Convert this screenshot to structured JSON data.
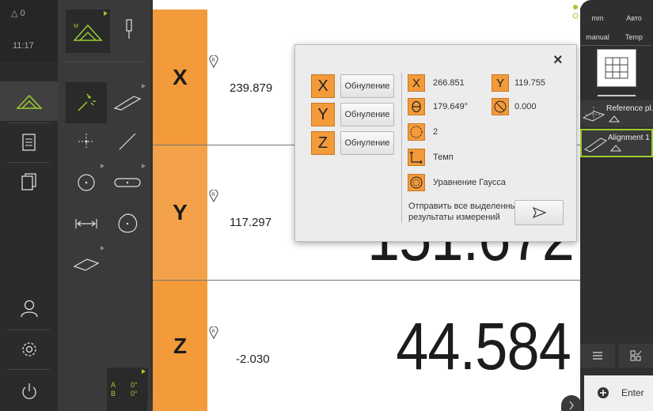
{
  "status": {
    "delta_label": "△ 0",
    "time": "11:17"
  },
  "function_panel": {
    "axes_a": "A",
    "axes_b": "B",
    "a_val": "0°",
    "b_val": "0°"
  },
  "axes": [
    {
      "name": "X",
      "small_value": "239.879",
      "big_value": ""
    },
    {
      "name": "Y",
      "small_value": "117.297",
      "big_value": ""
    },
    {
      "name": "Z",
      "small_value": "-2.030",
      "big_value": "44.584"
    }
  ],
  "behind_popup_value": "151.672",
  "inspector": {
    "unit_mm": "mm",
    "auto": "Авто",
    "manual": "manual",
    "temp": "Temp",
    "feature_1": "Reference pl...",
    "feature_2": "Alignment 1",
    "enter": "Enter"
  },
  "popup": {
    "close": "×",
    "reset_label": "Обнуление",
    "x_letter": "X",
    "y_letter": "Y",
    "z_letter": "Z",
    "res_x": "266.851",
    "res_y": "119.755",
    "res_theta": "179.649°",
    "res_form": "0.000",
    "res_points": "2",
    "res_temp": "Темп",
    "res_gauss": "Уравнение Гаусса",
    "send_text_1": "Отправить все выделенные",
    "send_text_2": "результаты измерений"
  },
  "colors": {
    "accent": "#f39a3a",
    "active_green": "#9acd32",
    "sidebar": "#2b2b2b"
  }
}
